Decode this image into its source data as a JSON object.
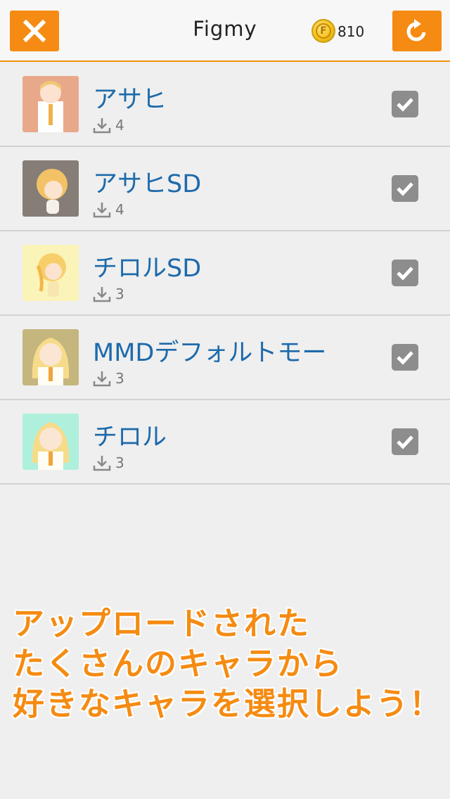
{
  "header": {
    "title": "Figmy",
    "close_icon": "close-icon",
    "refresh_icon": "refresh-icon",
    "coin_letter": "F",
    "coin_count": "810",
    "accent": "#f58b12"
  },
  "list": {
    "items": [
      {
        "name": "アサヒ",
        "downloads": "4",
        "checked": true,
        "thumb_bg": "#e8a98a"
      },
      {
        "name": "アサヒSD",
        "downloads": "4",
        "checked": true,
        "thumb_bg": "#857d76"
      },
      {
        "name": "チロルSD",
        "downloads": "3",
        "checked": true,
        "thumb_bg": "#fbf4b8"
      },
      {
        "name": "MMDデフォルトモー",
        "downloads": "3",
        "checked": true,
        "thumb_bg": "#c5b67e"
      },
      {
        "name": "チロル",
        "downloads": "3",
        "checked": true,
        "thumb_bg": "#aef0dc"
      }
    ]
  },
  "promo": {
    "lines": [
      "アップロードされた",
      "たくさんのキャラから",
      "好きなキャラを選択しよう！"
    ]
  }
}
